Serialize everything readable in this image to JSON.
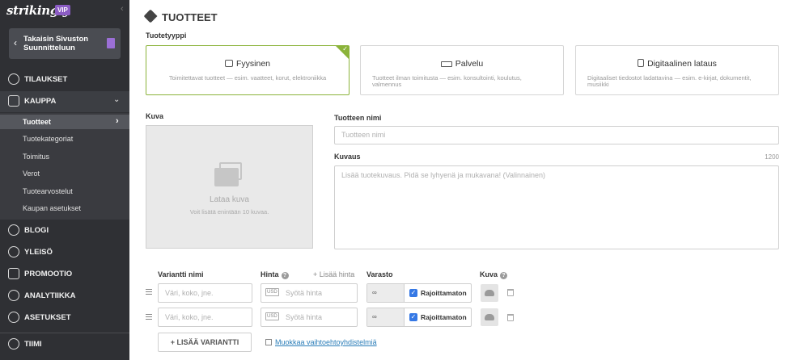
{
  "sidebar": {
    "logo": "strikingly",
    "badge": "VIP",
    "back_button_label": "Takaisin Sivuston Suunnitteluun",
    "items": [
      {
        "label": "TILAUKSET",
        "icon": "dollar-icon"
      },
      {
        "label": "KAUPPA",
        "icon": "store-icon"
      },
      {
        "label": "BLOGI",
        "icon": "pen-icon"
      },
      {
        "label": "YLEISÖ",
        "icon": "people-icon"
      },
      {
        "label": "PROMOOTIO",
        "icon": "megaphone-icon"
      },
      {
        "label": "ANALYTIIKKA",
        "icon": "analytics-icon"
      },
      {
        "label": "ASETUKSET",
        "icon": "gear-icon"
      },
      {
        "label": "TIIMI",
        "icon": "team-icon"
      }
    ],
    "kauppa_sub": [
      "Tuotteet",
      "Tuotekategoriat",
      "Toimitus",
      "Verot",
      "Tuotearvostelut",
      "Kaupan asetukset"
    ]
  },
  "main": {
    "title": "TUOTTEET",
    "type_label": "Tuotetyyppi",
    "types": [
      {
        "title": "Fyysinen",
        "desc": "Toimitettavat tuotteet — esim. vaatteet, korut, elektroniikka"
      },
      {
        "title": "Palvelu",
        "desc": "Tuotteet ilman toimitusta — esim. konsultointi, koulutus, valmennus"
      },
      {
        "title": "Digitaalinen lataus",
        "desc": "Digitaaliset tiedostot ladattavina — esim. e-kirjat, dokumentit, musiikki"
      }
    ],
    "image": {
      "label": "Kuva",
      "title": "Lataa kuva",
      "sub": "Voit lisätä enintään 10 kuvaa."
    },
    "name": {
      "label": "Tuotteen nimi",
      "placeholder": "Tuotteen nimi"
    },
    "description": {
      "label": "Kuvaus",
      "counter": "1200",
      "placeholder": "Lisää tuotekuvaus. Pidä se lyhyenä ja mukavana! (Valinnainen)"
    },
    "variants": {
      "col_name": "Variantti nimi",
      "col_price": "Hinta",
      "add_price": "+ Lisää hinta",
      "col_stock": "Varasto",
      "col_image": "Kuva",
      "name_placeholder": "Väri, koko, jne.",
      "currency": "USD",
      "price_placeholder": "Syötä hinta",
      "stock_value": "∞",
      "unlimited_label": "Rajoittamaton",
      "add_variant_label": "+ LISÄÄ VARIANTTI",
      "edit_options_label": "Muokkaa vaihtoehtoyhdistelmiä"
    }
  }
}
